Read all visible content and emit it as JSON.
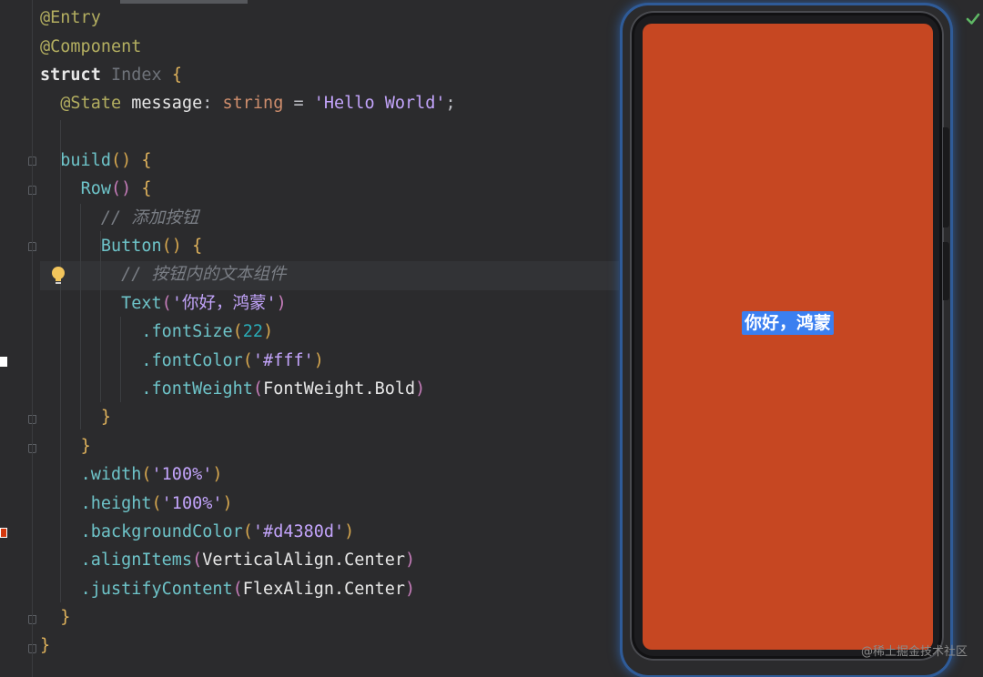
{
  "code": {
    "l1": "@Entry",
    "l2": "@Component",
    "l3_kw": "struct",
    "l3_name": "Index",
    "l4_dec": "@State",
    "l4_name": "message",
    "l4_type": "string",
    "l4_str": "'Hello World'",
    "l6_fn": "build",
    "l7_fn": "Row",
    "l8_cmt": "// 添加按钮",
    "l9_fn": "Button",
    "l10_cmt": "// 按钮内的文本组件",
    "l11_fn": "Text",
    "l11_str": "'你好，鸿蒙'",
    "l12_m": ".fontSize",
    "l12_num": "22",
    "l13_m": ".fontColor",
    "l13_str": "'#fff'",
    "l14_m": ".fontWeight",
    "l14_arg": "FontWeight.Bold",
    "l17_m": ".width",
    "l17_str": "'100%'",
    "l18_m": ".height",
    "l18_str": "'100%'",
    "l19_m": ".backgroundColor",
    "l19_str": "'#d4380d'",
    "l20_m": ".alignItems",
    "l20_arg": "VerticalAlign.Center",
    "l21_m": ".justifyContent",
    "l21_arg": "FlexAlign.Center"
  },
  "preview": {
    "button_text": "你好，鸿蒙",
    "background_color": "#d4380d",
    "button_color": "#3b7ff0"
  },
  "icons": {
    "bulb": "lightbulb-icon",
    "check": "check-icon"
  },
  "watermark": "@稀土掘金技术社区"
}
